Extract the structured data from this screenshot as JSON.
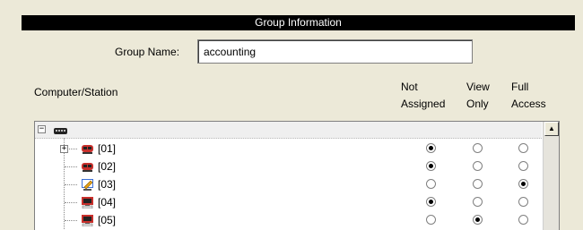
{
  "panel_title": "Group Information",
  "group_name": {
    "label": "Group Name:",
    "value": "accounting"
  },
  "columns": {
    "computer": "Computer/Station",
    "not_assigned": [
      "Not",
      "Assigned"
    ],
    "view_only": [
      "View",
      "Only"
    ],
    "full_access": [
      "Full",
      "Access"
    ]
  },
  "scrollbar": {
    "up_arrow": "▲"
  },
  "tree": {
    "root": {
      "icon": "network-switch-icon",
      "expanded": true
    },
    "rows": [
      {
        "label": "[01]",
        "icon": "red-computer-icon",
        "expandable": true,
        "access": "not_assigned"
      },
      {
        "label": "[02]",
        "icon": "red-computer-icon",
        "expandable": false,
        "access": "not_assigned"
      },
      {
        "label": "[03]",
        "icon": "edit-station-icon",
        "expandable": false,
        "access": "full_access"
      },
      {
        "label": "[04]",
        "icon": "monitor-station-icon",
        "expandable": false,
        "access": "not_assigned"
      },
      {
        "label": "[05]",
        "icon": "monitor-station-icon",
        "expandable": false,
        "access": "view_only"
      }
    ]
  }
}
